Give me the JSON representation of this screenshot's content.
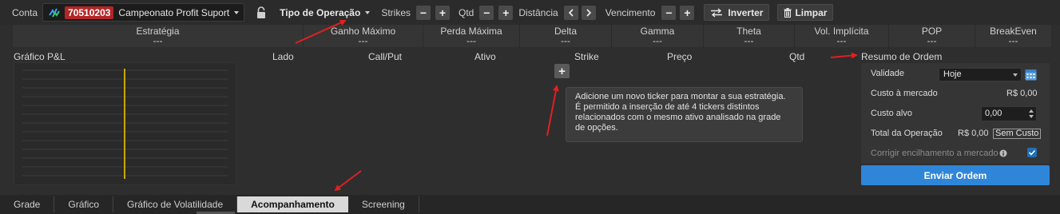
{
  "toolbar": {
    "conta_label": "Conta",
    "account_number": "70510203",
    "account_name": "Campeonato Profit Suport",
    "tipo_label": "Tipo de Operação",
    "strikes_label": "Strikes",
    "qtd_label": "Qtd",
    "distancia_label": "Distância",
    "vencimento_label": "Vencimento",
    "minus": "−",
    "plus": "+",
    "inverter_label": "Inverter",
    "limpar_label": "Limpar"
  },
  "metrics": [
    {
      "label": "Estratégia",
      "value": "---"
    },
    {
      "label": "Ganho Máximo",
      "value": "---"
    },
    {
      "label": "Perda Máxima",
      "value": "---"
    },
    {
      "label": "Delta",
      "value": "---"
    },
    {
      "label": "Gamma",
      "value": "---"
    },
    {
      "label": "Theta",
      "value": "---"
    },
    {
      "label": "Vol. Implícita",
      "value": "---"
    },
    {
      "label": "POP",
      "value": "---"
    },
    {
      "label": "BreakEven",
      "value": "---"
    }
  ],
  "columns": {
    "grafico": "Gráfico P&L",
    "lado": "Lado",
    "callput": "Call/Put",
    "ativo": "Ativo",
    "strike": "Strike",
    "preco": "Preço",
    "qtd": "Qtd",
    "resumo": "Resumo de Ordem"
  },
  "add_button": "+",
  "tooltip": {
    "line1": "Adicione um novo ticker para montar a sua estratégia.",
    "line2": "É permitido a inserção de até 4 tickers distintos",
    "line3": "relacionados com o mesmo ativo analisado na grade",
    "line4": "de opções."
  },
  "order": {
    "validade_label": "Validade",
    "validade_value": "Hoje",
    "custo_mercado_label": "Custo à mercado",
    "custo_mercado_value": "R$ 0,00",
    "custo_alvo_label": "Custo alvo",
    "custo_alvo_value": "0,00",
    "total_label": "Total da Operação",
    "total_value": "R$ 0,00",
    "sem_custo": "Sem Custo",
    "corrigir_label": "Corrigir encilhamento a mercado",
    "corrigir_checked": true,
    "enviar": "Enviar Ordem"
  },
  "tabs": [
    {
      "label": "Grade",
      "active": false
    },
    {
      "label": "Gráfico",
      "active": false
    },
    {
      "label": "Gráfico de Volatilidade",
      "active": false
    },
    {
      "label": "Acompanhamento",
      "active": true
    },
    {
      "label": "Screening",
      "active": false
    }
  ],
  "colors": {
    "accent_blue": "#2f86d9",
    "account_red": "#b32626",
    "annotation_red": "#e02020",
    "chart_line": "#c8a800"
  }
}
